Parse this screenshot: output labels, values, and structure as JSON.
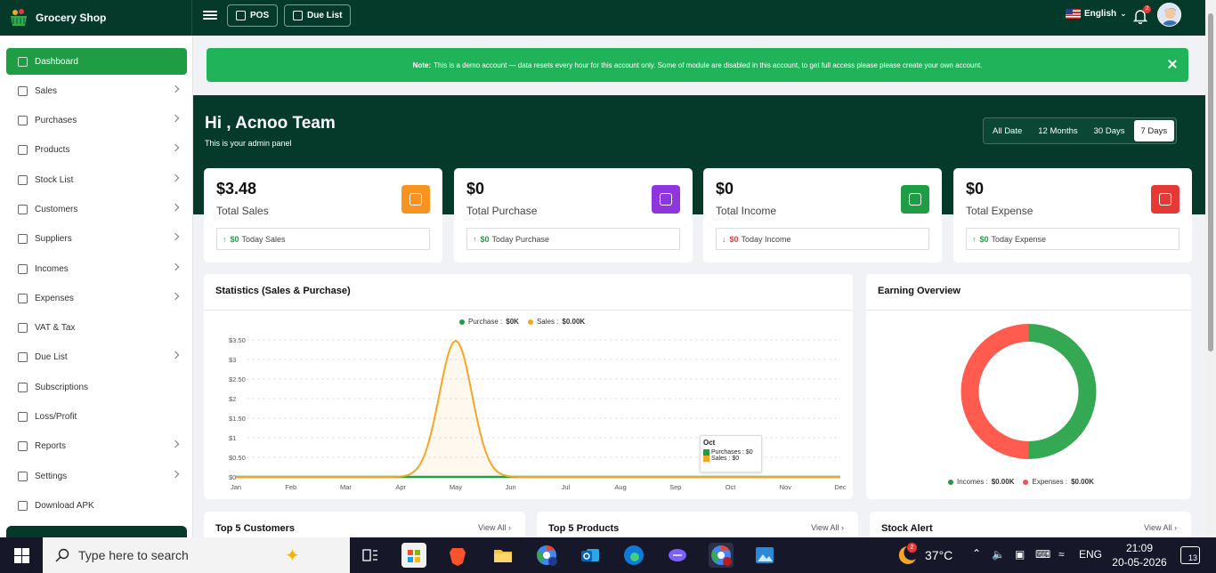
{
  "brand": {
    "name": "Grocery Shop"
  },
  "topbar": {
    "pos_label": "POS",
    "due_list_label": "Due List",
    "language": "English",
    "notification_count": "2"
  },
  "sidebar": {
    "items": [
      {
        "label": "Dashboard",
        "active": true,
        "arrow": false,
        "icon": "home-icon"
      },
      {
        "label": "Sales",
        "arrow": true,
        "icon": "tag-icon"
      },
      {
        "label": "Purchases",
        "arrow": true,
        "icon": "cart-icon"
      },
      {
        "label": "Products",
        "arrow": true,
        "icon": "box-icon"
      },
      {
        "label": "Stock List",
        "arrow": true,
        "icon": "list-icon"
      },
      {
        "label": "Customers",
        "arrow": true,
        "icon": "users-icon"
      },
      {
        "label": "Suppliers",
        "arrow": true,
        "icon": "truck-icon"
      },
      {
        "label": "Incomes",
        "arrow": true,
        "icon": "money-icon"
      },
      {
        "label": "Expenses",
        "arrow": true,
        "icon": "wallet-icon"
      },
      {
        "label": "VAT & Tax",
        "arrow": false,
        "icon": "percent-icon"
      },
      {
        "label": "Due List",
        "arrow": true,
        "icon": "clipboard-icon"
      },
      {
        "label": "Subscriptions",
        "arrow": false,
        "icon": "layers-icon"
      },
      {
        "label": "Loss/Profit",
        "arrow": false,
        "icon": "chart-icon"
      },
      {
        "label": "Reports",
        "arrow": true,
        "icon": "file-icon"
      },
      {
        "label": "Settings",
        "arrow": true,
        "icon": "gear-icon"
      },
      {
        "label": "Download APK",
        "arrow": false,
        "icon": "download-icon"
      }
    ]
  },
  "note": {
    "label": "Note:",
    "text": "This is a demo account — data resets every hour for this account only. Some of module are disabled in this account, to get full access please please create your own account."
  },
  "hero": {
    "greeting": "Hi , Acnoo Team",
    "subtitle": "This is your admin panel"
  },
  "range": {
    "options": [
      "All Date",
      "12 Months",
      "30 Days",
      "7 Days"
    ],
    "selected": "7 Days"
  },
  "stats": [
    {
      "value": "$3.48",
      "label": "Total Sales",
      "trend": "up",
      "amount": "$0",
      "foot": "Today Sales",
      "color": "#f7931e",
      "icon": "cart-icon"
    },
    {
      "value": "$0",
      "label": "Total Purchase",
      "trend": "up",
      "amount": "$0",
      "foot": "Today Purchase",
      "color": "#8e35e0",
      "icon": "box-icon"
    },
    {
      "value": "$0",
      "label": "Total Income",
      "trend": "down",
      "amount": "$0",
      "foot": "Today Income",
      "color": "#1f9d45",
      "icon": "money-bag-icon"
    },
    {
      "value": "$0",
      "label": "Total Expense",
      "trend": "up",
      "amount": "$0",
      "foot": "Today Expense",
      "color": "#e53935",
      "icon": "receipt-icon"
    }
  ],
  "statistics": {
    "title": "Statistics (Sales & Purchase)",
    "legend_purchase": "Purchase : ",
    "legend_purchase_val": "$0K",
    "legend_sales": "Sales : ",
    "legend_sales_val": "$0.00K",
    "tooltip": {
      "title": "Oct",
      "purchases": "Purchases : $0",
      "sales": "Sales : $0"
    }
  },
  "chart_data": [
    {
      "type": "area",
      "title": "Statistics (Sales & Purchase)",
      "categories": [
        "Jan",
        "Feb",
        "Mar",
        "Apr",
        "May",
        "Jun",
        "Jul",
        "Aug",
        "Sep",
        "Oct",
        "Nov",
        "Dec"
      ],
      "y_ticks": [
        "$0",
        "$0.50",
        "$1",
        "$1.50",
        "$2",
        "$2.50",
        "$3",
        "$3.50"
      ],
      "ylim": [
        0,
        3.5
      ],
      "grid": true,
      "legend": "top",
      "series": [
        {
          "name": "Purchase",
          "color": "#1f9d45",
          "values": [
            0,
            0,
            0,
            0,
            0,
            0,
            0,
            0,
            0,
            0,
            0,
            0
          ]
        },
        {
          "name": "Sales",
          "color": "#f5a623",
          "values": [
            0,
            0,
            0,
            0,
            3.48,
            0,
            0,
            0,
            0,
            0,
            0,
            0
          ]
        }
      ]
    },
    {
      "type": "pie",
      "title": "Earning Overview",
      "legend": "bottom",
      "series": [
        {
          "name": "Incomes",
          "value": 0,
          "color": "#34a853"
        },
        {
          "name": "Expenses",
          "value": 0,
          "color": "#ff5b4f"
        }
      ]
    }
  ],
  "earning": {
    "title": "Earning Overview",
    "incomes": "Incomes : ",
    "incomes_val": "$0.00K",
    "expenses": "Expenses : ",
    "expenses_val": "$0.00K"
  },
  "bottom": {
    "customers": "Top 5 Customers",
    "products": "Top 5 Products",
    "stock": "Stock Alert",
    "view_all": "View All"
  },
  "taskbar": {
    "search_placeholder": "Type here to search",
    "temperature": "37°C",
    "lang": "ENG",
    "time": "21:09",
    "date": "20-05-2026",
    "notif": "13",
    "weather_badge": "2"
  }
}
